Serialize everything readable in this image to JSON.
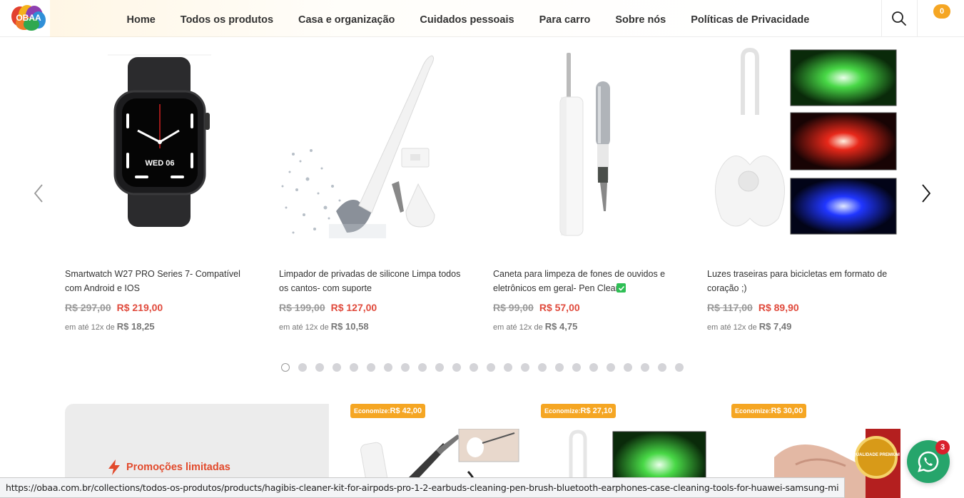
{
  "header": {
    "logo_text": "OBAA",
    "nav": [
      "Home",
      "Todos os produtos",
      "Casa e organização",
      "Cuidados pessoais",
      "Para carro",
      "Sobre nós",
      "Políticas de Privacidade"
    ],
    "cart_count": "0"
  },
  "carousel": {
    "products": [
      {
        "title": "Smartwatch W27 PRO Series 7- Compatível com Android e IOS",
        "old_price": "R$ 297,00",
        "new_price": "R$ 219,00",
        "inst_prefix": "em até 12x de",
        "inst_value": "R$ 18,25",
        "watch_text": "WED 06"
      },
      {
        "title": "Limpador de privadas de silicone Limpa todos os cantos- com suporte",
        "old_price": "R$ 199,00",
        "new_price": "R$ 127,00",
        "inst_prefix": "em até 12x de",
        "inst_value": "R$ 10,58"
      },
      {
        "title": "Caneta para limpeza de fones de ouvidos e eletrônicos em geral- Pen Clean",
        "old_price": "R$ 99,00",
        "new_price": "R$ 57,00",
        "inst_prefix": "em até 12x de",
        "inst_value": "R$ 4,75"
      },
      {
        "title": "Luzes traseiras para bicicletas em formato de coração ;)",
        "old_price": "R$ 117,00",
        "new_price": "R$ 89,90",
        "inst_prefix": "em até 12x de",
        "inst_value": "R$ 7,49"
      }
    ],
    "dot_count": 24,
    "active_dot": 1
  },
  "promo": {
    "label": "Promoções limitadas",
    "badges": [
      {
        "prefix": "Economize:",
        "value": "R$ 42,00"
      },
      {
        "prefix": "Economize:",
        "value": "R$ 27,10"
      },
      {
        "prefix": "Economize:",
        "value": "R$ 30,00"
      }
    ],
    "seal_text": "QUALIDADE PREMIUM"
  },
  "whatsapp": {
    "badge": "3"
  },
  "statusbar": {
    "url": "https://obaa.com.br/collections/todos-os-produtos/products/hagibis-cleaner-kit-for-airpods-pro-1-2-earbuds-cleaning-pen-brush-bluetooth-earphones-case-cleaning-tools-for-huawei-samsung-mi"
  },
  "colors": {
    "accent": "#f5a623",
    "sale": "#e04a3c",
    "whatsapp": "#26a56b",
    "promo": "#e24a2c"
  }
}
